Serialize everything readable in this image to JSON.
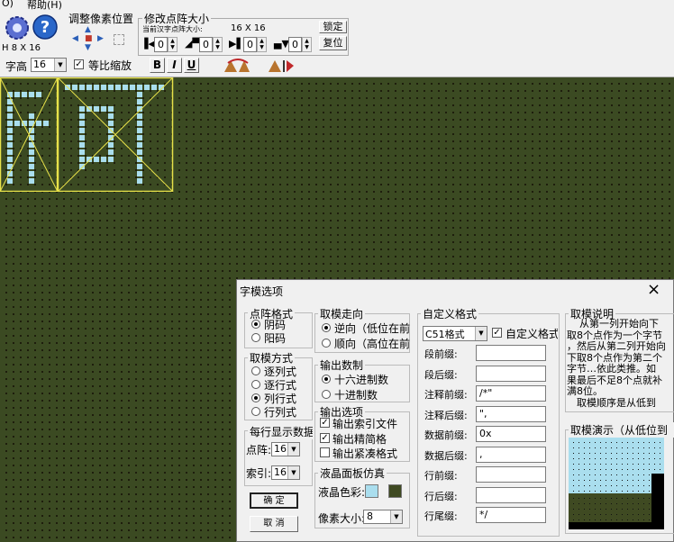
{
  "menu": {
    "item0": "O)",
    "help": "帮助(H)"
  },
  "toolbar": {
    "size_label": "H 8 X 16",
    "adjust_title": "调整像素位置",
    "modify_title": "修改点阵大小",
    "current_size_label": "当前汉字点阵大小:",
    "current_size_value": "16 X 16",
    "lock_button": "锁定",
    "reset_button": "复位",
    "spin1": "0",
    "spin2": "0",
    "spin3": "0",
    "spin4": "0",
    "font_height_label": "字高",
    "font_height_value": "16",
    "proportional_label": "等比缩放",
    "bold": "B",
    "italic": "I",
    "underline": "U"
  },
  "dialog": {
    "title": "字模选项",
    "close": "×",
    "dot_format": {
      "legend": "点阵格式",
      "options": [
        "阴码",
        "阳码"
      ]
    },
    "mode": {
      "legend": "取模方式",
      "options": [
        "逐列式",
        "逐行式",
        "列行式",
        "行列式"
      ]
    },
    "per_line": {
      "legend": "每行显示数据",
      "dot_label": "点阵:",
      "dot_value": "16",
      "index_label": "索引:",
      "index_value": "16"
    },
    "ok": "确 定",
    "cancel": "取 消",
    "direction": {
      "legend": "取模走向",
      "options": [
        "逆向（低位在前",
        "顺向（高位在前"
      ]
    },
    "number_system": {
      "legend": "输出数制",
      "options": [
        "十六进制数",
        "十进制数"
      ]
    },
    "output": {
      "legend": "输出选项",
      "options": [
        "输出索引文件",
        "输出精简格",
        "输出紧凑格式"
      ]
    },
    "lcd": {
      "legend": "液晶面板仿真",
      "color_label": "液晶色彩:",
      "pixel_label": "像素大小:",
      "pixel_value": "8",
      "lcd_color": "#aadeee",
      "dark_color": "#3f4a22"
    },
    "custom": {
      "legend": "自定义格式",
      "format_value": "C51格式",
      "custom_check": "自定义格式",
      "fields": [
        {
          "label": "段前缀:",
          "value": ""
        },
        {
          "label": "段后缀:",
          "value": ""
        },
        {
          "label": "注释前缀:",
          "value": "/*\""
        },
        {
          "label": "注释后缀:",
          "value": "\","
        },
        {
          "label": "数据前缀:",
          "value": "0x"
        },
        {
          "label": "数据后缀:",
          "value": ","
        },
        {
          "label": "行前缀:",
          "value": ""
        },
        {
          "label": "行后缀:",
          "value": ""
        },
        {
          "label": "行尾缀:",
          "value": "*/"
        }
      ]
    },
    "explain": {
      "legend": "取模说明",
      "text": [
        "从第一列开始向下",
        "取8个点作为一个字节",
        "，然后从第二列开始向",
        "下取8个点作为第二个",
        "字节…依此类推。如",
        "果最后不足8个点就补",
        "满8位。",
        "　取模顺序是从低到"
      ]
    },
    "demo": {
      "legend": "取模演示（从低位到"
    }
  }
}
